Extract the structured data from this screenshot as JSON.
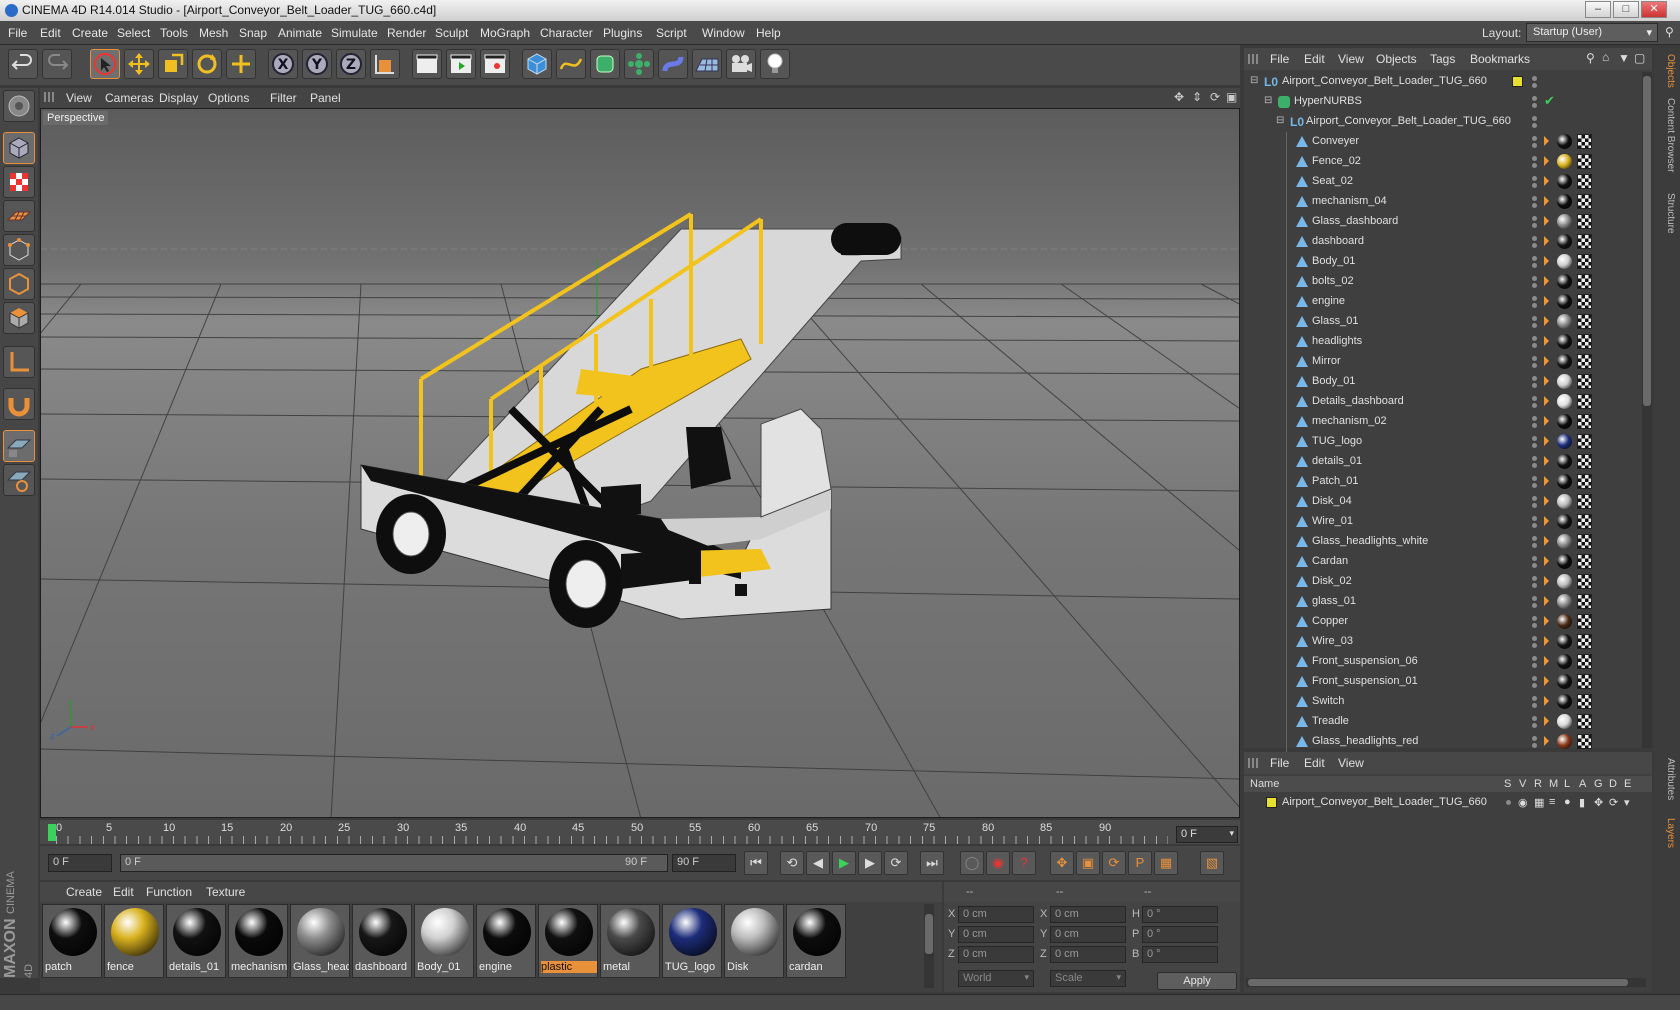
{
  "window": {
    "title": "CINEMA 4D R14.014 Studio - [Airport_Conveyor_Belt_Loader_TUG_660.c4d]"
  },
  "menu": [
    "File",
    "Edit",
    "Create",
    "Select",
    "Tools",
    "Mesh",
    "Snap",
    "Animate",
    "Simulate",
    "Render",
    "Sculpt",
    "MoGraph",
    "Character",
    "Plugins",
    "Script",
    "Window",
    "Help"
  ],
  "layout": {
    "label": "Layout:",
    "value": "Startup (User)"
  },
  "viewport": {
    "menu": [
      "View",
      "Cameras",
      "Display",
      "Options",
      "Filter",
      "Panel"
    ],
    "label": "Perspective"
  },
  "timeline": {
    "ticks": [
      "0",
      "5",
      "10",
      "15",
      "20",
      "25",
      "30",
      "35",
      "40",
      "45",
      "50",
      "55",
      "60",
      "65",
      "70",
      "75",
      "80",
      "85",
      "90"
    ],
    "frame": "0 F"
  },
  "transport": {
    "start": "0 F",
    "range_start": "0 F",
    "range_end": "90 F",
    "end": "90 F"
  },
  "materials": {
    "menu": [
      "Create",
      "Edit",
      "Function",
      "Texture"
    ],
    "items": [
      {
        "label": "patch",
        "color": "#0e0e0e"
      },
      {
        "label": "fence",
        "color": "#d9b21f"
      },
      {
        "label": "details_01",
        "color": "#111111"
      },
      {
        "label": "mechanism",
        "color": "#0a0a0a"
      },
      {
        "label": "Glass_head",
        "color": "#8d8d8d"
      },
      {
        "label": "dashboard",
        "color": "#171717"
      },
      {
        "label": "Body_01",
        "color": "#d0d0d0"
      },
      {
        "label": "engine",
        "color": "#0c0c0c"
      },
      {
        "label": "plastic",
        "color": "#101010"
      },
      {
        "label": "metal",
        "color": "#4a4a4a"
      },
      {
        "label": "TUG_logo",
        "color": "#1d2d7a"
      },
      {
        "label": "Disk",
        "color": "#bcbcbc"
      },
      {
        "label": "cardan",
        "color": "#0d0d0d"
      }
    ]
  },
  "coords": {
    "head": [
      "--",
      "--",
      "--"
    ],
    "rows": [
      {
        "a": "X",
        "av": "0 cm",
        "b": "X",
        "bv": "0 cm",
        "c": "H",
        "cv": "0 °"
      },
      {
        "a": "Y",
        "av": "0 cm",
        "b": "Y",
        "bv": "0 cm",
        "c": "P",
        "cv": "0 °"
      },
      {
        "a": "Z",
        "av": "0 cm",
        "b": "Z",
        "bv": "0 cm",
        "c": "B",
        "cv": "0 °"
      }
    ],
    "world": "World",
    "scale": "Scale",
    "apply": "Apply"
  },
  "objects": {
    "menu": [
      "File",
      "Edit",
      "View",
      "Objects",
      "Tags",
      "Bookmarks"
    ],
    "root": "Airport_Conveyor_Belt_Loader_TUG_660",
    "nurbs": "HyperNURBS",
    "group": "Airport_Conveyor_Belt_Loader_TUG_660",
    "items": [
      {
        "name": "Conveyer",
        "tag": "#101010"
      },
      {
        "name": "Fence_02",
        "tag": "#d9b21f"
      },
      {
        "name": "Seat_02",
        "tag": "#111111"
      },
      {
        "name": "mechanism_04",
        "tag": "#0d0d0d"
      },
      {
        "name": "Glass_dashboard",
        "tag": "#8a8a8a"
      },
      {
        "name": "dashboard",
        "tag": "#151515"
      },
      {
        "name": "Body_01",
        "tag": "#cfcfcf"
      },
      {
        "name": "bolts_02",
        "tag": "#111111"
      },
      {
        "name": "engine",
        "tag": "#0f0f0f"
      },
      {
        "name": "Glass_01",
        "tag": "#8a8a8a"
      },
      {
        "name": "headlights",
        "tag": "#121212"
      },
      {
        "name": "Mirror",
        "tag": "#131313"
      },
      {
        "name": "Body_01",
        "tag": "#cfcfcf"
      },
      {
        "name": "Details_dashboard",
        "tag": "#e0e0e0"
      },
      {
        "name": "mechanism_02",
        "tag": "#0d0d0d"
      },
      {
        "name": "TUG_logo",
        "tag": "#1d2d7a"
      },
      {
        "name": "details_01",
        "tag": "#111111"
      },
      {
        "name": "Patch_01",
        "tag": "#0e0e0e"
      },
      {
        "name": "Disk_04",
        "tag": "#bcbcbc"
      },
      {
        "name": "Wire_01",
        "tag": "#141414"
      },
      {
        "name": "Glass_headlights_white",
        "tag": "#8a8a8a"
      },
      {
        "name": "Cardan",
        "tag": "#0d0d0d"
      },
      {
        "name": "Disk_02",
        "tag": "#bcbcbc"
      },
      {
        "name": "glass_01",
        "tag": "#8a8a8a"
      },
      {
        "name": "Copper",
        "tag": "#4a2a16"
      },
      {
        "name": "Wire_03",
        "tag": "#141414"
      },
      {
        "name": "Front_suspension_06",
        "tag": "#121212"
      },
      {
        "name": "Front_suspension_01",
        "tag": "#121212"
      },
      {
        "name": "Switch",
        "tag": "#0f0f0f"
      },
      {
        "name": "Treadle",
        "tag": "#d8d8d8"
      },
      {
        "name": "Glass_headlights_red",
        "tag": "#8a3a1a"
      }
    ]
  },
  "layers": {
    "menu": [
      "File",
      "Edit",
      "View"
    ],
    "header_name": "Name",
    "cols": [
      "S",
      "V",
      "R",
      "M",
      "L",
      "A",
      "G",
      "D",
      "E"
    ],
    "item": "Airport_Conveyor_Belt_Loader_TUG_660"
  },
  "sidetabs": [
    "Objects",
    "Content Browser",
    "Structure",
    "Attributes",
    "Layers"
  ],
  "brand": {
    "line1": "MAXON",
    "line2": "CINEMA 4D"
  }
}
